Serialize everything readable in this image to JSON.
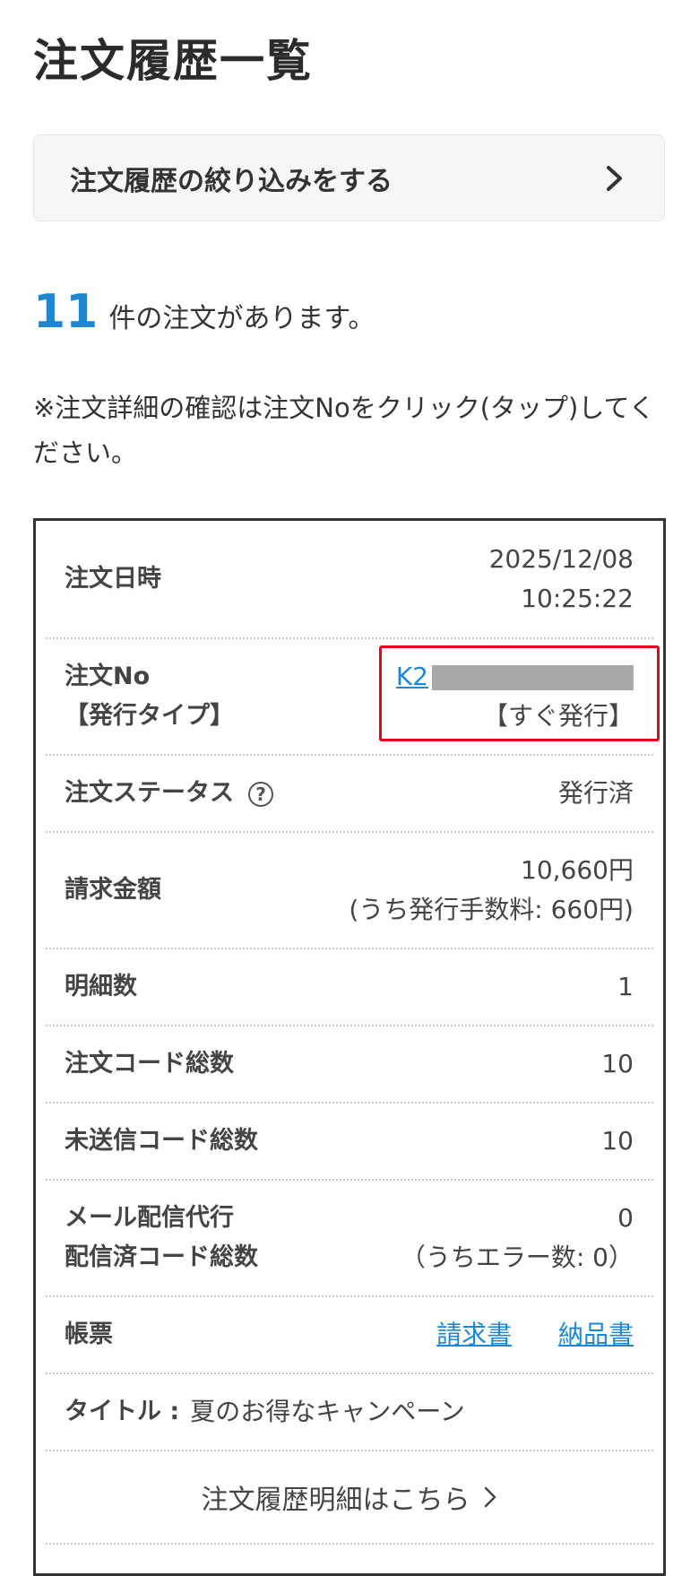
{
  "page": {
    "title": "注文履歴一覧",
    "filter_label": "注文履歴の絞り込みをする",
    "count": "11",
    "count_suffix": "件の注文があります。",
    "note": "※注文詳細の確認は注文Noをクリック(タップ)してください。"
  },
  "order": {
    "datetime_label": "注文日時",
    "date": "2025/12/08",
    "time": "10:25:22",
    "order_no_label": "注文No",
    "issue_type_label": "【発行タイプ】",
    "order_no": "K2",
    "issue_type": "【すぐ発行】",
    "status_label": "注文ステータス",
    "status_help": "?",
    "status": "発行済",
    "amount_label": "請求金額",
    "amount": "10,660円",
    "amount_fee": "(うち発行手数料: 660円)",
    "items_label": "明細数",
    "items": "1",
    "codes_label": "注文コード総数",
    "codes": "10",
    "unsent_label": "未送信コード総数",
    "unsent": "10",
    "mail_label_1": "メール配信代行",
    "mail_label_2": "配信済コード総数",
    "mail_sent": "0",
    "mail_errors": "（うちエラー数: 0）",
    "docs_label": "帳票",
    "invoice_link": "請求書",
    "delivery_link": "納品書",
    "title_label": "タイトル :",
    "title_value": "夏のお得なキャンペーン",
    "detail_link": "注文履歴明細はこちら"
  },
  "colors": {
    "accent": "#1f87d0",
    "highlight": "#e0001b",
    "card_border": "#333333"
  },
  "icons": {
    "filter_chevron": "chevron-right-icon",
    "detail_chevron": "chevron-right-icon",
    "help": "question-circle-icon"
  }
}
